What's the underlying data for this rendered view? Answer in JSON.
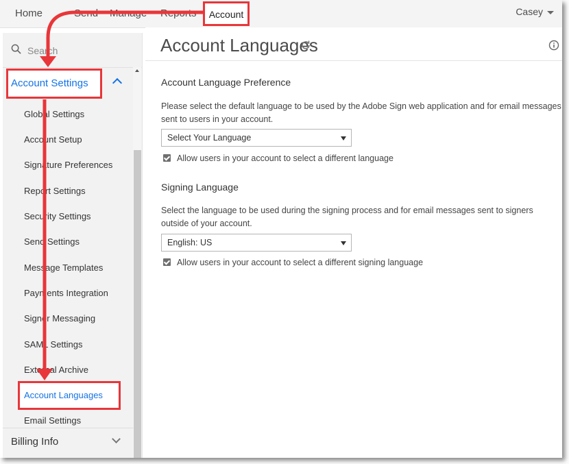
{
  "topnav": {
    "items": [
      "Home",
      "Send",
      "Manage",
      "Reports"
    ],
    "active": "Account",
    "user": "Casey"
  },
  "sidebar": {
    "search_placeholder": "Search",
    "section": "Account Settings",
    "items": [
      "Global Settings",
      "Account Setup",
      "Signature Preferences",
      "Report Settings",
      "Security Settings",
      "Send Settings",
      "Message Templates",
      "Payments Integration",
      "Signer Messaging",
      "SAML Settings",
      "External Archive",
      "Account Languages",
      "Email Settings"
    ],
    "active_item": "Account Languages",
    "billing": "Billing Info"
  },
  "main": {
    "title": "Account Languages",
    "pref": {
      "heading": "Account Language Preference",
      "description": "Please select the default language to be used by the Adobe Sign web application and for email messages sent to users in your account.",
      "select_value": "Select Your Language",
      "checkbox_label": "Allow users in your account to select a different language"
    },
    "signing": {
      "heading": "Signing Language",
      "description": "Select the language to be used during the signing process and for email messages sent to signers outside of your account.",
      "select_value": "English: US",
      "checkbox_label": "Allow users in your account to select a different signing language"
    }
  },
  "colors": {
    "highlight": "#e8363a",
    "link_blue": "#1473e6"
  }
}
